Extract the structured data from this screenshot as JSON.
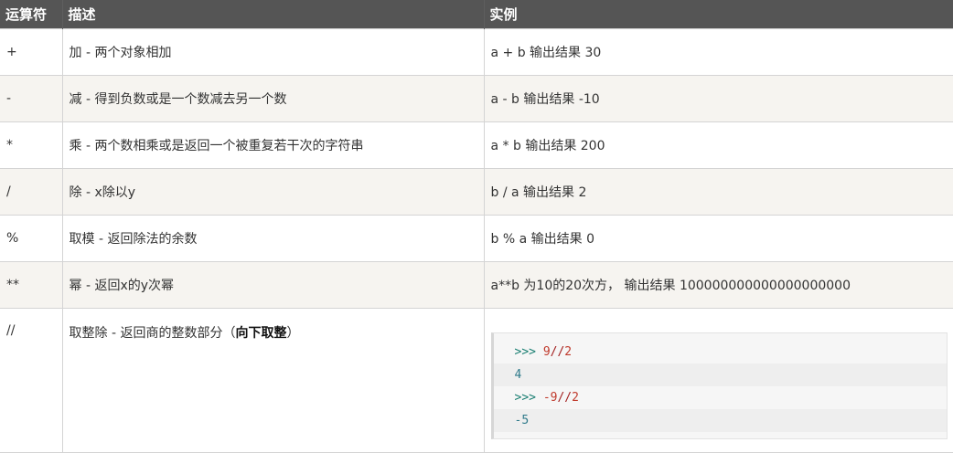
{
  "headers": {
    "operator": "运算符",
    "description": "描述",
    "example": "实例"
  },
  "rows": [
    {
      "operator": "+",
      "description": "加 - 两个对象相加",
      "example": "a + b 输出结果 30"
    },
    {
      "operator": "-",
      "description": "减 - 得到负数或是一个数减去另一个数",
      "example": "a - b 输出结果 -10"
    },
    {
      "operator": "*",
      "description": "乘 - 两个数相乘或是返回一个被重复若干次的字符串",
      "example": "a * b 输出结果 200"
    },
    {
      "operator": "/",
      "description": "除 - x除以y",
      "example": "b / a 输出结果 2"
    },
    {
      "operator": "%",
      "description": "取模 - 返回除法的余数",
      "example": "b % a 输出结果 0"
    },
    {
      "operator": "**",
      "description": "幂 - 返回x的y次幂",
      "example": "a**b 为10的20次方， 输出结果 100000000000000000000"
    },
    {
      "operator": "//",
      "description_prefix": "取整除 - 返回商的整数部分（",
      "description_bold": "向下取整",
      "description_suffix": "）",
      "code": {
        "prompt": ">>>",
        "line1_num": "9",
        "op": "//",
        "line1_num2": "2",
        "line2": "4",
        "line3_num": "-9",
        "line3_num2": "2",
        "line4": "-5"
      }
    }
  ]
}
